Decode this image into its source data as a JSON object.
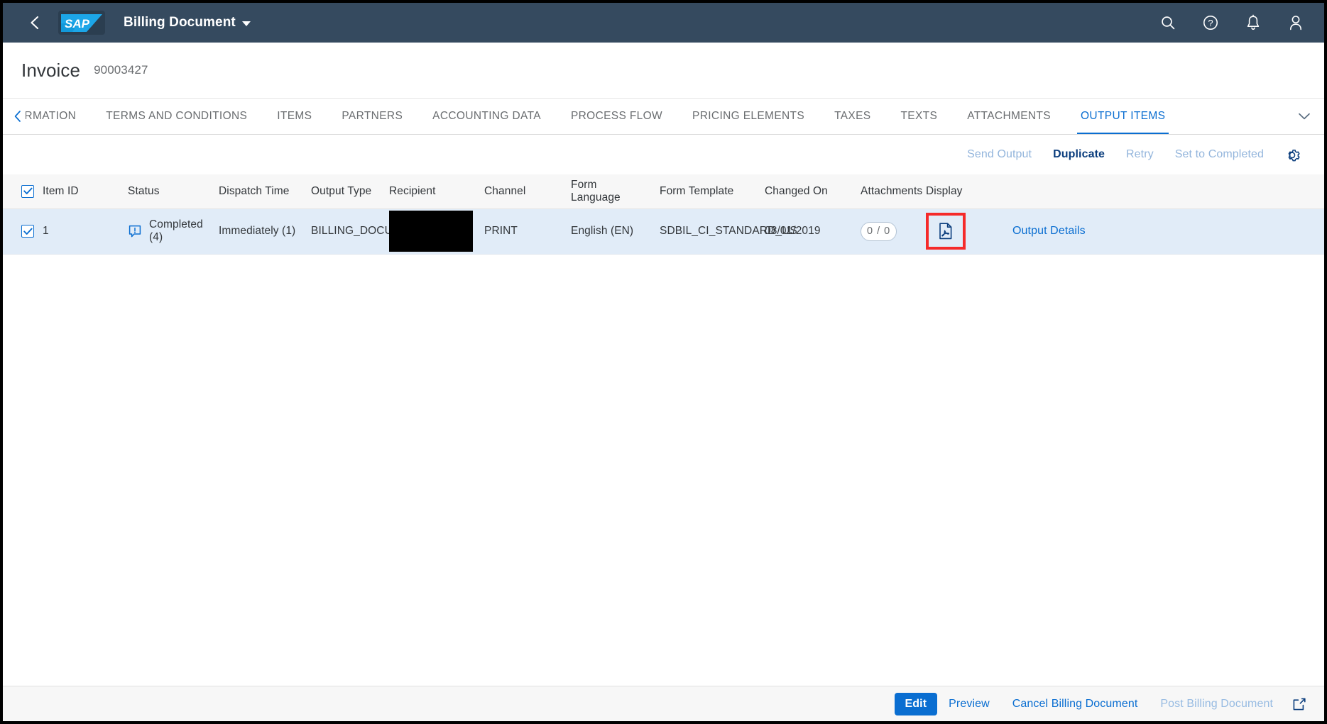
{
  "shellbar": {
    "back_icon": "back-arrow-icon",
    "logo_text": "SAP",
    "title": "Billing Document",
    "icons": [
      {
        "name": "search-icon",
        "label": "Search"
      },
      {
        "name": "help-icon",
        "label": "Help"
      },
      {
        "name": "bell-icon",
        "label": "Notifications"
      },
      {
        "name": "user-icon",
        "label": "User"
      }
    ]
  },
  "object_header": {
    "title": "Invoice",
    "subtitle": "90003427"
  },
  "tabs": {
    "scroll_left_icon": "chevron-left-icon",
    "overflow_icon": "chevron-down-icon",
    "items": [
      {
        "label": "ORMATION",
        "active": false
      },
      {
        "label": "TERMS AND CONDITIONS",
        "active": false
      },
      {
        "label": "ITEMS",
        "active": false
      },
      {
        "label": "PARTNERS",
        "active": false
      },
      {
        "label": "ACCOUNTING DATA",
        "active": false
      },
      {
        "label": "PROCESS FLOW",
        "active": false
      },
      {
        "label": "PRICING ELEMENTS",
        "active": false
      },
      {
        "label": "TAXES",
        "active": false
      },
      {
        "label": "TEXTS",
        "active": false
      },
      {
        "label": "ATTACHMENTS",
        "active": false
      },
      {
        "label": "OUTPUT ITEMS",
        "active": true
      }
    ]
  },
  "toolbar": {
    "send_output_label": "Send Output",
    "duplicate_label": "Duplicate",
    "retry_label": "Retry",
    "set_completed_label": "Set to Completed",
    "settings_icon": "gear-icon"
  },
  "table": {
    "select_all_checked": true,
    "columns": [
      "Item ID",
      "Status",
      "Dispatch Time",
      "Output Type",
      "Recipient",
      "Channel",
      "Form Language",
      "Form Template",
      "Changed On",
      "Attachments",
      "Display"
    ],
    "row": {
      "selected": true,
      "item_id": "1",
      "status_icon": "message-information-icon",
      "status": "Completed (4)",
      "dispatch_time": "Immediately (1)",
      "output_type": "BILLING_DOCUMENT",
      "recipient": "",
      "channel": "PRINT",
      "form_language": "English (EN)",
      "form_template": "SDBIL_CI_STANDARD_US",
      "changed_on": "08/01/2019",
      "attachments": "0 / 0",
      "display_icon": "pdf-document-icon",
      "details_link": "Output Details"
    }
  },
  "footer": {
    "edit_label": "Edit",
    "preview_label": "Preview",
    "cancel_label": "Cancel Billing Document",
    "post_label": "Post Billing Document",
    "share_icon": "share-export-icon"
  },
  "colors": {
    "shell_bg": "#354a5f",
    "accent": "#0a6ed1",
    "row_selected_bg": "#e1ecf8",
    "highlight_box": "#f52a2a",
    "disabled_action": "#93b5dc"
  }
}
